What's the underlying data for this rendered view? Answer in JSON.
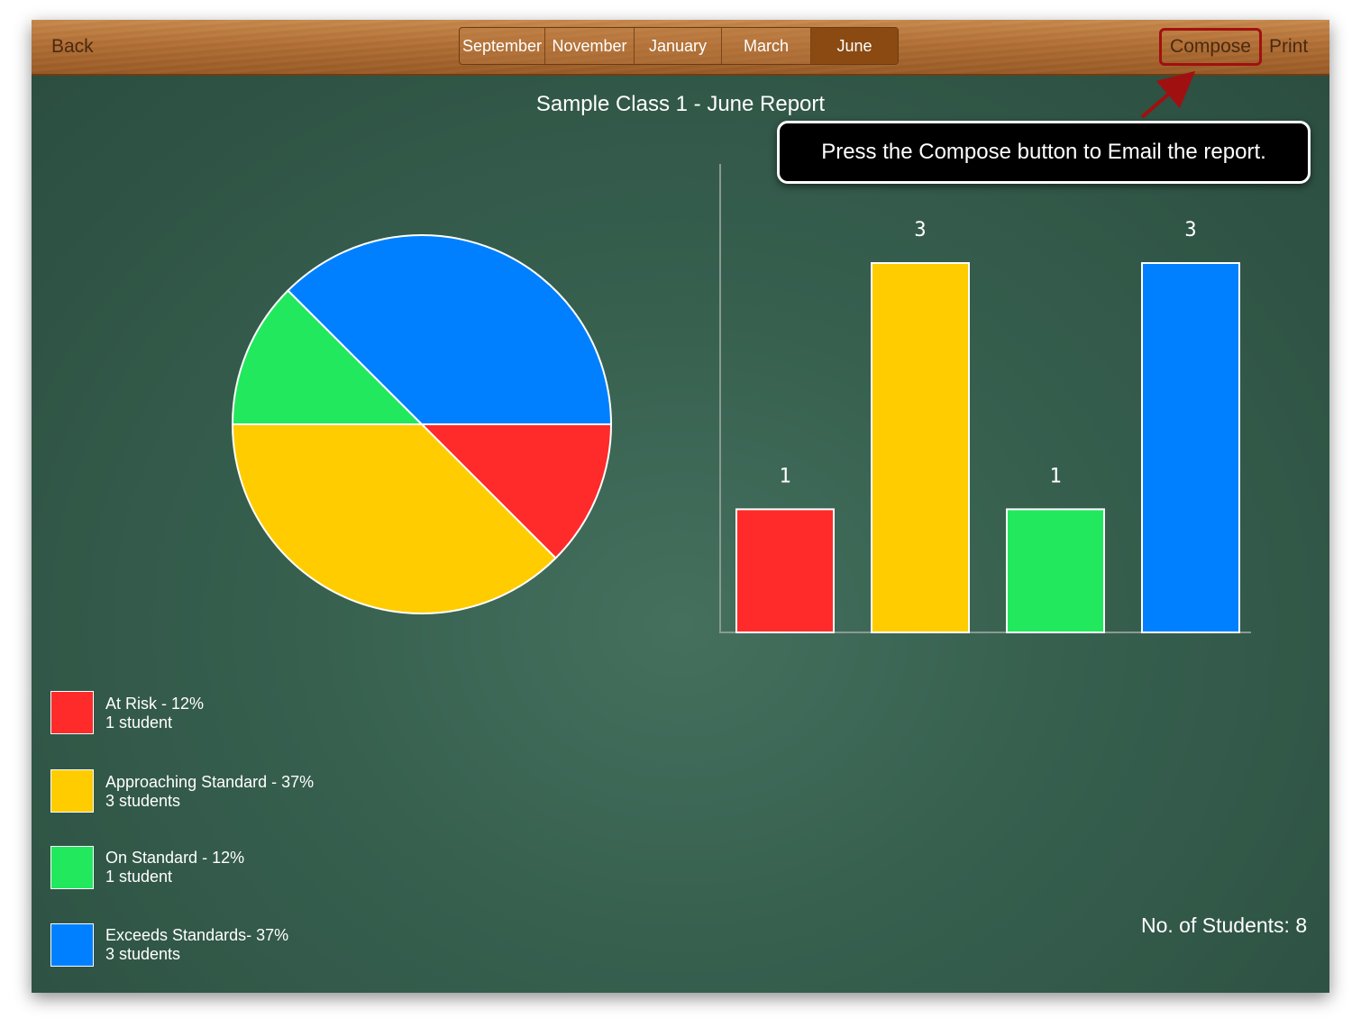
{
  "toolbar": {
    "back_label": "Back",
    "months": [
      {
        "label": "September",
        "active": false
      },
      {
        "label": "November",
        "active": false
      },
      {
        "label": "January",
        "active": false
      },
      {
        "label": "March",
        "active": false
      },
      {
        "label": "June",
        "active": true
      }
    ],
    "compose_label": "Compose",
    "print_label": "Print"
  },
  "report": {
    "title": "Sample Class 1 - June Report",
    "student_count": "No. of Students: 8"
  },
  "callout": {
    "text": "Press the Compose button to Email the report."
  },
  "legend": [
    {
      "title": "At Risk - 12%",
      "subtitle": "1 student",
      "color": "#ff2a2a"
    },
    {
      "title": "Approaching Standard - 37%",
      "subtitle": "3 students",
      "color": "#ffcc00"
    },
    {
      "title": "On Standard - 12%",
      "subtitle": "1 student",
      "color": "#22e85e"
    },
    {
      "title": "Exceeds Standards- 37%",
      "subtitle": "3 students",
      "color": "#0080ff"
    }
  ],
  "chart_data": [
    {
      "type": "pie",
      "categories": [
        "At Risk",
        "Approaching Standard",
        "On Standard",
        "Exceeds Standards"
      ],
      "values": [
        1,
        3,
        1,
        3
      ],
      "colors": [
        "#ff2a2a",
        "#ffcc00",
        "#22e85e",
        "#0080ff"
      ]
    },
    {
      "type": "bar",
      "categories": [
        "At Risk",
        "Approaching Standard",
        "On Standard",
        "Exceeds Standards"
      ],
      "values": [
        1,
        3,
        1,
        3
      ],
      "data_labels": [
        "1",
        "3",
        "1",
        "3"
      ],
      "colors": [
        "#ff2a2a",
        "#ffcc00",
        "#22e85e",
        "#0080ff"
      ],
      "grid": false
    }
  ]
}
